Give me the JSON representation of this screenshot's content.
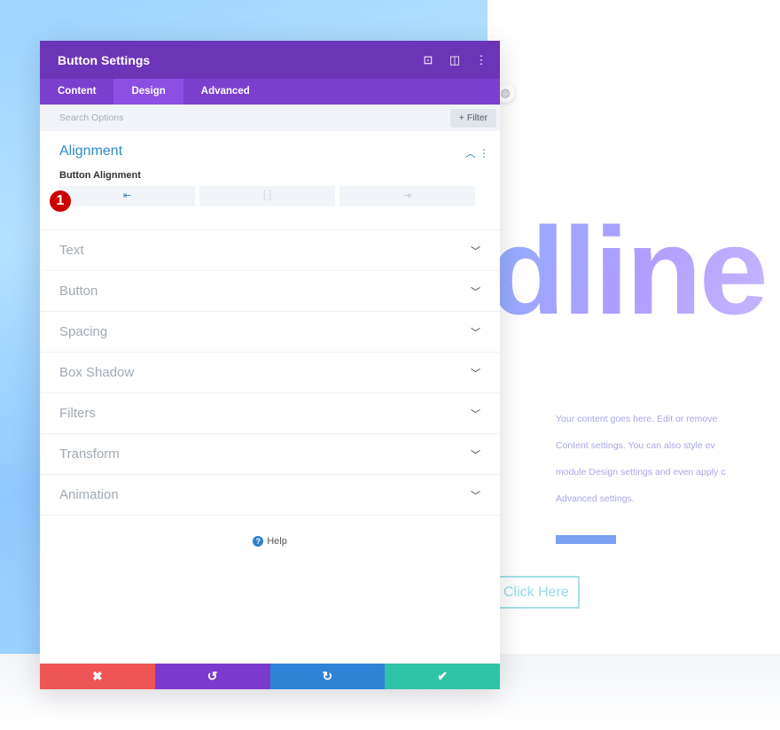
{
  "background": {
    "headline": "dline",
    "paragraph": [
      "Your content goes here. Edit or remove",
      "Content settings. You can also style ev",
      "module Design settings and even apply c",
      "Advanced settings."
    ],
    "button": "Click Here"
  },
  "panel": {
    "title": "Button Settings",
    "header_icons": [
      "focus-icon",
      "split-view-icon",
      "more-icon"
    ],
    "tabs": [
      {
        "label": "Content"
      },
      {
        "label": "Design"
      },
      {
        "label": "Advanced"
      }
    ],
    "search_placeholder": "Search Options",
    "filter": "+ Filter",
    "alignment": {
      "title": "Alignment",
      "field_label": "Button Alignment",
      "options": [
        "left",
        "center",
        "right"
      ],
      "selected": "left",
      "badge": "1"
    },
    "sections": [
      "Text",
      "Button",
      "Spacing",
      "Box Shadow",
      "Filters",
      "Transform",
      "Animation"
    ],
    "help": "Help",
    "footer": {
      "colors": {
        "cancel": "#ef5555",
        "undo": "#7b3acd",
        "redo": "#2f82d6",
        "save": "#2ec4a5"
      }
    }
  }
}
